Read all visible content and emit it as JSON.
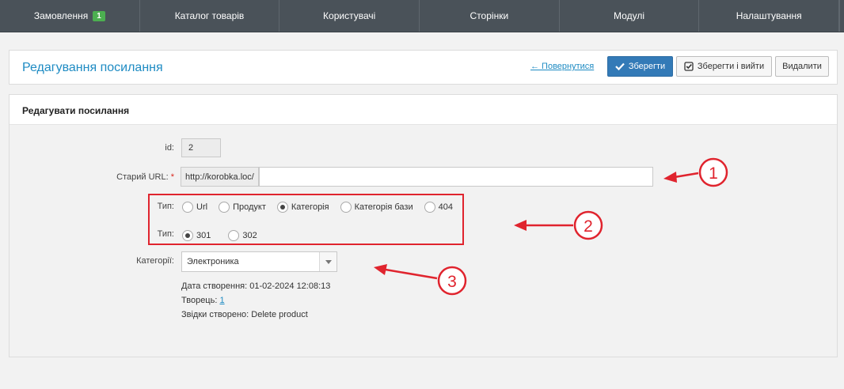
{
  "nav": {
    "items": [
      {
        "label": "Замовлення",
        "badge": "1"
      },
      {
        "label": "Каталог товарів"
      },
      {
        "label": "Користувачі"
      },
      {
        "label": "Сторінки"
      },
      {
        "label": "Модулі"
      },
      {
        "label": "Налаштування"
      }
    ]
  },
  "header": {
    "title": "Редагування посилання",
    "back_label": "← Повернутися",
    "save_label": "Зберегти",
    "save_exit_label": "Зберегти і вийти",
    "delete_label": "Видалити"
  },
  "form": {
    "section_title": "Редагувати посилання",
    "id_label": "id:",
    "id_value": "2",
    "old_url_label": "Старий URL:",
    "required_mark": "*",
    "url_prefix": "http://korobka.loc/",
    "url_value": "",
    "type_label": "Тип:",
    "type_options": [
      {
        "label": "Url",
        "checked": false
      },
      {
        "label": "Продукт",
        "checked": false
      },
      {
        "label": "Категорія",
        "checked": true
      },
      {
        "label": "Категорія бази",
        "checked": false
      },
      {
        "label": "404",
        "checked": false
      }
    ],
    "redirect_label": "Тип:",
    "redirect_options": [
      {
        "label": "301",
        "checked": true
      },
      {
        "label": "302",
        "checked": false
      }
    ],
    "category_label": "Категорії:",
    "category_value": "Электроника",
    "created_date": "Дата створення: 01-02-2024 12:08:13",
    "creator_label": "Творець:",
    "creator_value": "1",
    "created_from": "Звідки створено: Delete product"
  },
  "annotations": [
    {
      "number": "1"
    },
    {
      "number": "2"
    },
    {
      "number": "3"
    }
  ],
  "colors": {
    "nav_bg": "#4a5259",
    "accent": "#1e8bc3",
    "primary_button": "#337ab7",
    "badge": "#4caf50",
    "annotation": "#e0242e"
  }
}
